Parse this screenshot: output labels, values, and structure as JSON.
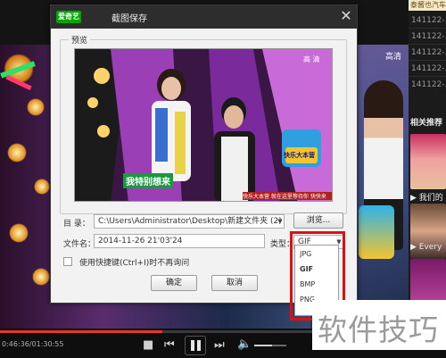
{
  "dialog": {
    "logo_text": "爱奇艺",
    "title": "截图保存",
    "preview_label": "预览",
    "preview_overlay": {
      "channel_mark": "高 清",
      "caption": "我特别想来",
      "show_logo": "快乐大本营",
      "ticker": "快乐大本营 就在这里等待你 快快来"
    },
    "directory": {
      "label": "目  录：",
      "value": "C:\\Users\\Administrator\\Desktop\\新建文件夹 (2)",
      "browse_label": "浏览..."
    },
    "filename": {
      "label": "文件名：",
      "value": "2014-11-26 21'03'24"
    },
    "type": {
      "label": "类型：",
      "selected": "GIF",
      "options": [
        "JPG",
        "GIF",
        "BMP",
        "PNG"
      ]
    },
    "shortcut_checkbox": {
      "label": "使用快捷键(Ctrl+I)时不再询问",
      "checked": false
    },
    "ok_label": "确定",
    "cancel_label": "取消"
  },
  "right_panel": {
    "top_strip": "泰酱也汽车",
    "items": [
      "141122-...",
      "141122-...",
      "141122-...",
      "141122-...",
      "141122-..."
    ],
    "section_title": "相关推荐",
    "recommendations": [
      {
        "caption": "我们的"
      },
      {
        "caption": "Every"
      }
    ]
  },
  "player": {
    "time": "0:46:36/01:30:55",
    "progress": 0.52,
    "volume": 0.55,
    "background_overlay": {
      "channel_mark": "高清"
    }
  },
  "watermark": "软件技巧",
  "colors": {
    "accent_red": "#e01010",
    "logo_green": "#00a700",
    "progress_red": "#e23a2a"
  }
}
